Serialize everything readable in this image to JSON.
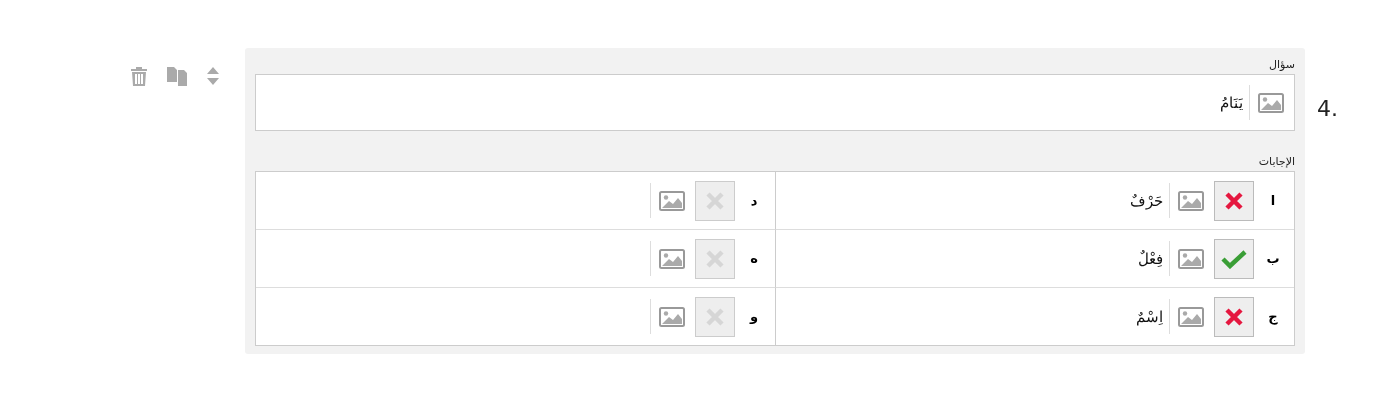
{
  "number": "4.",
  "question": {
    "label": "سؤال",
    "text": "يَنَامُ"
  },
  "answers_label": "الإجابات",
  "answers": [
    {
      "letter": "ا",
      "text": "حَرْفٌ",
      "correct": false,
      "disabled": false
    },
    {
      "letter": "د",
      "correct": false,
      "disabled": true
    },
    {
      "letter": "ب",
      "text": "فِعْلٌ",
      "correct": true,
      "disabled": false
    },
    {
      "letter": "ه",
      "correct": false,
      "disabled": true
    },
    {
      "letter": "ج",
      "text": "اِسْمٌ",
      "correct": false,
      "disabled": false
    },
    {
      "letter": "و",
      "correct": false,
      "disabled": true
    }
  ]
}
